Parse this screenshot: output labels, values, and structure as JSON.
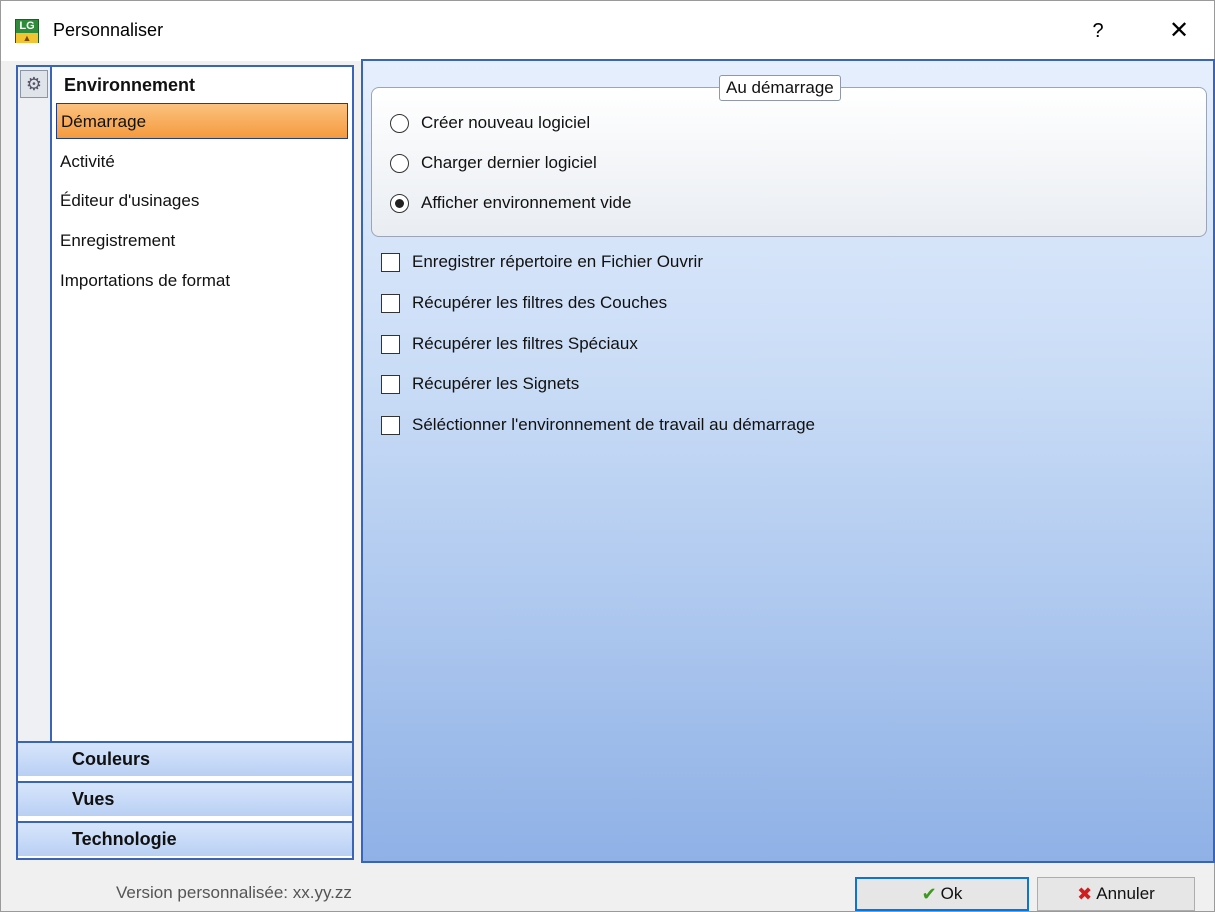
{
  "window": {
    "title": "Personnaliser",
    "help_label": "?",
    "close_label": "✕"
  },
  "nav": {
    "section_title": "Environnement",
    "items": [
      {
        "label": "Démarrage",
        "selected": true
      },
      {
        "label": "Activité"
      },
      {
        "label": "Éditeur d'usinages"
      },
      {
        "label": "Enregistrement"
      },
      {
        "label": "Importations de format"
      }
    ],
    "groups": [
      {
        "label": "Couleurs"
      },
      {
        "label": "Vues"
      },
      {
        "label": "Technologie"
      }
    ]
  },
  "content": {
    "groupbox_title": "Au démarrage",
    "radios": [
      {
        "label": "Créer nouveau logiciel",
        "checked": false
      },
      {
        "label": "Charger dernier logiciel",
        "checked": false
      },
      {
        "label": "Afficher environnement vide",
        "checked": true
      }
    ],
    "checkboxes": [
      {
        "label": "Enregistrer répertoire en Fichier Ouvrir",
        "checked": false
      },
      {
        "label": "Récupérer les filtres des Couches",
        "checked": false
      },
      {
        "label": "Récupérer les filtres Spéciaux",
        "checked": false
      },
      {
        "label": "Récupérer les Signets",
        "checked": false
      },
      {
        "label": "Séléctionner l'environnement de travail au démarrage",
        "checked": false
      }
    ]
  },
  "footer": {
    "version_text": "Version personnalisée: xx.yy.zz",
    "ok_label": "Ok",
    "cancel_label": "Annuler"
  },
  "colors": {
    "accent_border": "#3a64b8",
    "selected_item": "#f59a3d"
  }
}
